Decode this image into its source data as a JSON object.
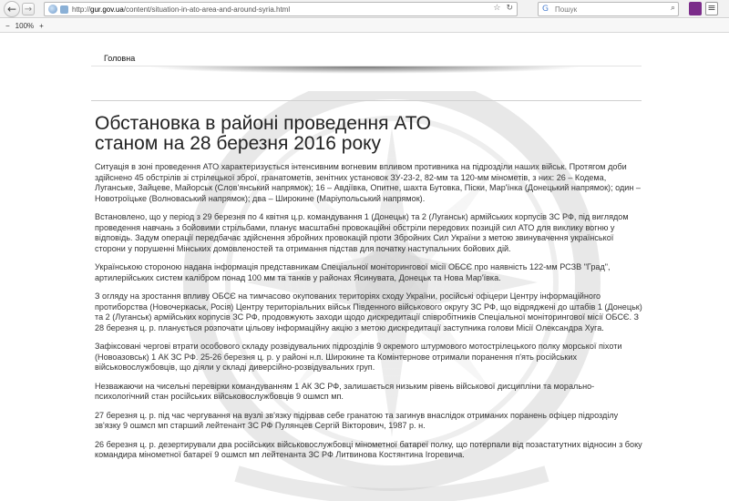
{
  "browser": {
    "url_prefix": "http://",
    "url_host": "gur.gov.ua",
    "url_path": "/content/situation-in-ato-area-and-around-syria.html",
    "search_placeholder": "Пошук",
    "zoom": "100%",
    "back_glyph": "←",
    "forward_glyph": "→",
    "star_glyph": "☆",
    "reload_glyph": "↻",
    "zoom_out_glyph": "−",
    "zoom_in_glyph": "+",
    "search_engine_glyph": "G",
    "search_glyph": "⌕",
    "menu_glyph": "≡"
  },
  "menu": {
    "home": "Головна"
  },
  "article": {
    "title_line1": "Обстановка в районі проведення АТО",
    "title_line2": "станом на 28 березня 2016 року",
    "paragraphs": [
      "Ситуація в зоні проведення АТО характеризується інтенсивним вогневим впливом противника на підрозділи наших військ. Протягом доби здійснено 45 обстрілів зі стрілецької зброї, гранатометів, зенітних установок ЗУ-23-2, 82-мм та 120-мм мінометів, з них: 26 – Кодема, Луганське, Зайцеве, Майорськ (Слов'янський напрямок); 16 – Авдіївка, Опитне, шахта Бутовка, Піски, Мар'їнка (Донецький напрямок); один – Новотроїцьке (Волноваський напрямок); два – Широкине (Маріупольський напрямок).",
      "Встановлено, що у період з 29 березня по 4 квітня ц.р. командування 1 (Донецьк) та 2 (Луганськ) армійських корпусів ЗС РФ, під виглядом проведення навчань з бойовими стрільбами, планує масштабні провокаційні обстріли передових позицій сил АТО для виклику вогню у відповідь. Задум операції передбачає здійснення збройних провокацій проти Збройних Сил України з метою звинувачення української сторони у порушенні Мінських домовленостей та отримання підстав для початку наступальних бойових дій.",
      "Українською стороною надана інформація представникам Спеціальної моніторингової місії ОБСЄ про наявність 122-мм РСЗВ \"Град\", артилерійських систем калібром понад 100 мм та танків у районах Ясинувата, Донецьк та Нова Мар'ївка.",
      "З огляду на зростання впливу ОБСЄ на тимчасово окупованих територіях сходу України, російські офіцери Центру інформаційного протиборства (Новочеркаськ, Росія) Центру територіальних військ Південного військового округу ЗС РФ, що відряджені до штабів 1 (Донецьк) та 2 (Луганськ) армійських корпусів ЗС РФ, продовжують заходи щодо дискредитації співробітників Спеціальної моніторингової місії ОБСЄ. З 28 березня ц. р. планується розпочати цільову інформаційну акцію з метою дискредитації заступника голови Місії Олександра Хуга.",
      "Зафіксовані чергові втрати особового складу розвідувальних підрозділів 9 окремого штурмового мотострілецького полку морської піхоти (Новоазовськ) 1 АК ЗС РФ. 25-26 березня ц. р. у районі н.п. Широкине та Комінтернове отримали поранення п'ять російських військовослужбовців, що діяли у складі диверсійно-розвідувальних груп.",
      "Незважаючи на чисельні перевірки командуванням 1 АК ЗС РФ, залишається низьким рівень військової дисципліни та морально-психологічний стан російських військовослужбовців 9 ошмсп мп.",
      "27 березня ц. р. під час чергування на вузлі зв'язку підірвав себе гранатою та загинув внаслідок отриманих поранень офіцер підрозділу зв'язку 9 ошмсп мп старший лейтенант ЗС РФ Пулянцев Сергій Вікторович, 1987 р. н.",
      "26 березня ц. р. дезертирували два російських військовослужбовці мінометної батареї полку, що потерпали від позастатутних відносин з боку командира мінометної батареї 9 ошмсп мп лейтенанта ЗС РФ Литвинова Костянтина Ігоревича."
    ]
  },
  "watermark": {
    "seal_text": "ДЕФЕНСОЛОГІЯ РАЗВЕДУВАЛЬНОГО · ЗАФЕСТОНАЛЬНО"
  }
}
